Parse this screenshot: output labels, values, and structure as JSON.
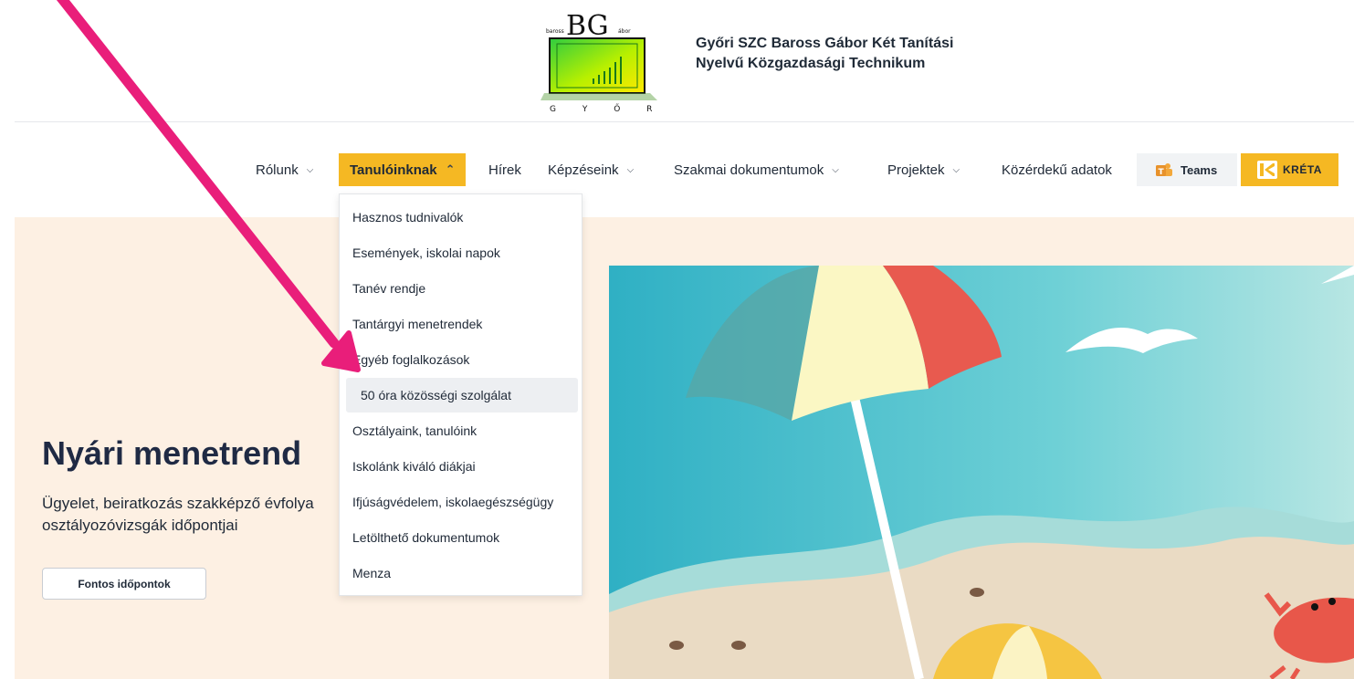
{
  "header": {
    "logo": {
      "top_text": "BG",
      "left_small": "baross",
      "right_small": "ábor",
      "bottom_text": "G Y Ő R"
    },
    "school_name_line1": "Győri SZC Baross Gábor Két Tanítási",
    "school_name_line2": "Nyelvű Közgazdasági Technikum"
  },
  "nav": {
    "items": [
      {
        "label": "Rólunk",
        "has_chevron": true
      },
      {
        "label": "Tanulóinknak",
        "has_chevron": true,
        "active": true
      },
      {
        "label": "Hírek",
        "has_chevron": false
      },
      {
        "label": "Képzéseink",
        "has_chevron": true
      },
      {
        "label": "Szakmai dokumentumok",
        "has_chevron": true
      },
      {
        "label": "Projektek",
        "has_chevron": true
      },
      {
        "label": "Közérdekű adatok",
        "has_chevron": false
      }
    ],
    "teams_label": "Teams",
    "kreta_label": "KRÉTA"
  },
  "dropdown": {
    "items": [
      "Hasznos tudnivalók",
      "Események, iskolai napok",
      "Tanév rendje",
      "Tantárgyi menetrendek",
      "Egyéb foglalkozások",
      "50 óra közösségi szolgálat",
      "Osztályaink, tanulóink",
      "Iskolánk kiváló diákjai",
      "Ifjúságvédelem, iskolaegészségügy",
      "Letölthető dokumentumok",
      "Menza"
    ],
    "hovered_index": 5
  },
  "hero": {
    "title": "Nyári menetrend",
    "subtitle_line1": "Ügyelet, beiratkozás szakképző évfolya",
    "subtitle_line2": "osztályozóvizsgák időpontjai",
    "button_label": "Fontos időpontok"
  },
  "colors": {
    "accent": "#f5b823",
    "hero_bg": "#fdf0e3",
    "arrow": "#e91e7a",
    "sea": "#5cc4d0",
    "sand": "#eadbc4"
  },
  "icons": {
    "chevron": "chevron-down-icon",
    "chevron_up": "chevron-up-icon",
    "teams": "teams-icon",
    "kreta": "kreta-logo-icon"
  }
}
